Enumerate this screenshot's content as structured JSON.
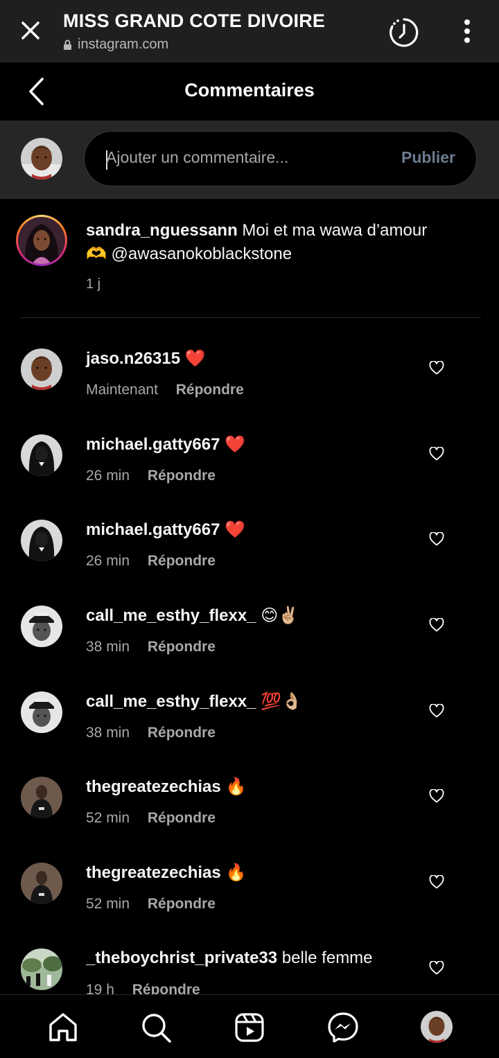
{
  "browser": {
    "title": "MISS GRAND COTE DIVOIRE",
    "url": "instagram.com"
  },
  "header": {
    "title": "Commentaires"
  },
  "composer": {
    "placeholder": "Ajouter un commentaire...",
    "publish_label": "Publier"
  },
  "caption": {
    "username": "sandra_nguessann",
    "text_line1": "Moi et ma wawa d’amour",
    "text_line2": "🫶 @awasanokoblackstone",
    "time": "1 j"
  },
  "reply_label": "Répondre",
  "comments": [
    {
      "username": "jaso.n26315",
      "text": "❤️",
      "time": "Maintenant",
      "avatar": "person-face-avatar"
    },
    {
      "username": "michael.gatty667",
      "text": "❤️",
      "time": "26 min",
      "avatar": "hooded-figure-avatar"
    },
    {
      "username": "michael.gatty667",
      "text": "❤️",
      "time": "26 min",
      "avatar": "hooded-figure-avatar"
    },
    {
      "username": "call_me_esthy_flexx_",
      "text": "😊✌🏼",
      "time": "38 min",
      "avatar": "cap-portrait-avatar"
    },
    {
      "username": "call_me_esthy_flexx_",
      "text": "💯👌🏼",
      "time": "38 min",
      "avatar": "cap-portrait-avatar"
    },
    {
      "username": "thegreatezechias",
      "text": "🔥",
      "time": "52 min",
      "avatar": "dark-portrait-avatar"
    },
    {
      "username": "thegreatezechias",
      "text": "🔥",
      "time": "52 min",
      "avatar": "dark-portrait-avatar"
    },
    {
      "username": "_theboychrist_private33",
      "text": "belle femme",
      "time": "19 h",
      "avatar": "garden-chess-avatar"
    }
  ],
  "nav": [
    "home-icon",
    "search-icon",
    "reels-icon",
    "messenger-icon",
    "profile-avatar"
  ],
  "colors": {
    "background": "#000000",
    "browser_bar": "#1f1f1f",
    "composer_bar": "#262626",
    "muted_text": "#a8a8a8",
    "publish_disabled": "#6b7c8e"
  }
}
